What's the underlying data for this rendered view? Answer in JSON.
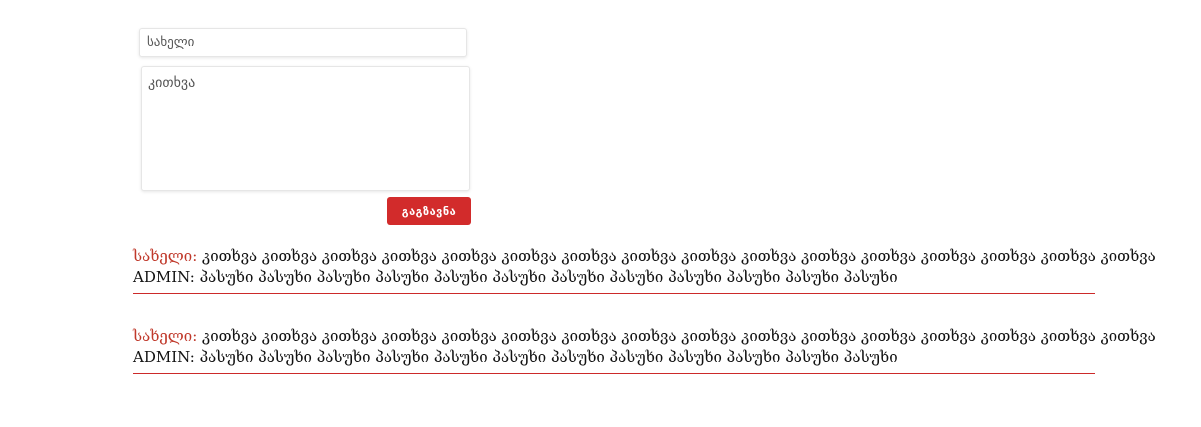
{
  "form": {
    "name_placeholder": "სახელი",
    "question_placeholder": "კითხვა",
    "send_label": "გაგზავნა"
  },
  "qa": [
    {
      "name_label": "სახელი:",
      "question": "კითხვა კითხვა კითხვა კითხვა კითხვა კითხვა კითხვა კითხვა კითხვა კითხვა კითხვა კითხვა კითხვა კითხვა კითხვა კითხვა",
      "admin_label": "ADMIN:",
      "answer": "პასუხი პასუხი პასუხი პასუხი პასუხი პასუხი პასუხი პასუხი პასუხი პასუხი პასუხი პასუხი"
    },
    {
      "name_label": "სახელი:",
      "question": "კითხვა კითხვა კითხვა კითხვა კითხვა კითხვა კითხვა კითხვა კითხვა კითხვა კითხვა კითხვა კითხვა კითხვა კითხვა კითხვა",
      "admin_label": "ADMIN:",
      "answer": "პასუხი პასუხი პასუხი პასუხი პასუხი პასუხი პასუხი პასუხი პასუხი პასუხი პასუხი პასუხი"
    }
  ],
  "colors": {
    "accent": "#d22b2b",
    "label": "#c0392b",
    "divider": "#cc2a2a"
  }
}
